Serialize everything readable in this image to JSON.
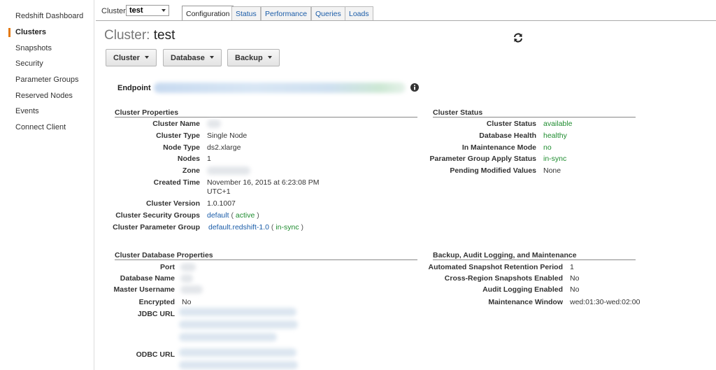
{
  "sidebar": {
    "items": [
      {
        "label": "Redshift Dashboard"
      },
      {
        "label": "Clusters"
      },
      {
        "label": "Snapshots"
      },
      {
        "label": "Security"
      },
      {
        "label": "Parameter Groups"
      },
      {
        "label": "Reserved Nodes"
      },
      {
        "label": "Events"
      },
      {
        "label": "Connect Client"
      }
    ]
  },
  "topbar": {
    "cluster_label": "Cluster:",
    "cluster_value": "test",
    "tabs": [
      {
        "label": "Configuration"
      },
      {
        "label": "Status"
      },
      {
        "label": "Performance"
      },
      {
        "label": "Queries"
      },
      {
        "label": "Loads"
      }
    ]
  },
  "header": {
    "title_prefix": "Cluster:",
    "title_name": "test",
    "refresh_icon": "refresh-icon"
  },
  "actions": {
    "cluster": "Cluster",
    "database": "Database",
    "backup": "Backup"
  },
  "endpoint": {
    "label": "Endpoint",
    "info_icon": "info-icon"
  },
  "cluster_properties": {
    "title": "Cluster Properties",
    "cluster_name_label": "Cluster Name",
    "cluster_type_label": "Cluster Type",
    "cluster_type": "Single Node",
    "node_type_label": "Node Type",
    "node_type": "ds2.xlarge",
    "nodes_label": "Nodes",
    "nodes": "1",
    "zone_label": "Zone",
    "created_time_label": "Created Time",
    "created_time_line1": "November 16, 2015 at 6:23:08 PM",
    "created_time_line2": "UTC+1",
    "cluster_version_label": "Cluster Version",
    "cluster_version": "1.0.1007",
    "security_groups_label": "Cluster Security Groups",
    "security_group_name": "default",
    "security_group_status": "active",
    "parameter_group_label": "Cluster Parameter Group",
    "parameter_group_name": "default.redshift-1.0",
    "parameter_group_status": "in-sync",
    "open_paren": "(",
    "close_paren": ")"
  },
  "cluster_status": {
    "title": "Cluster Status",
    "cluster_status_label": "Cluster Status",
    "cluster_status": "available",
    "database_health_label": "Database Health",
    "database_health": "healthy",
    "maintenance_mode_label": "In Maintenance Mode",
    "maintenance_mode": "no",
    "param_apply_label": "Parameter Group Apply Status",
    "param_apply": "in-sync",
    "pending_label": "Pending Modified Values",
    "pending": "None",
    "status_color": "#1e8c2f"
  },
  "database_properties": {
    "title": "Cluster Database Properties",
    "port_label": "Port",
    "database_name_label": "Database Name",
    "master_username_label": "Master Username",
    "encrypted_label": "Encrypted",
    "encrypted": "No",
    "jdbc_label": "JDBC URL",
    "odbc_label": "ODBC URL"
  },
  "backup": {
    "title": "Backup, Audit Logging, and Maintenance",
    "retention_label": "Automated Snapshot Retention Period",
    "retention": "1",
    "cross_region_label": "Cross-Region Snapshots Enabled",
    "cross_region": "No",
    "audit_logging_label": "Audit Logging Enabled",
    "audit_logging": "No",
    "maintenance_window_label": "Maintenance Window",
    "maintenance_window": "wed:01:30-wed:02:00"
  },
  "colors": {
    "accent": "#e47911",
    "link": "#1a5ca8",
    "ok": "#1e8c2f"
  }
}
